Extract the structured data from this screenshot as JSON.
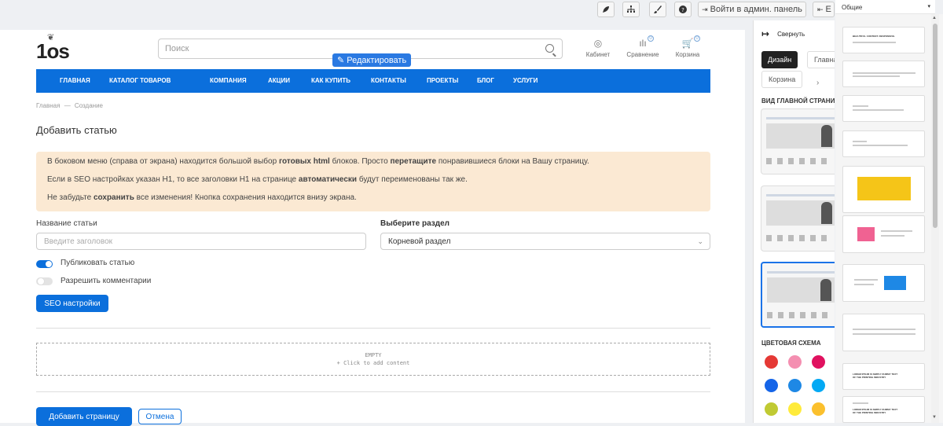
{
  "topbar": {
    "button_admin": "Войти в админ. панель",
    "button_exit": "Е"
  },
  "header": {
    "logo": "1os",
    "search_placeholder": "Поиск",
    "cabinet": "Кабинет",
    "compare": "Сравнение",
    "compare_count": "0",
    "cart": "Корзина",
    "cart_count": "0",
    "edit_button": "Редактировать"
  },
  "nav": {
    "items": [
      "ГЛАВНАЯ",
      "КАТАЛОГ ТОВАРОВ",
      "КОМПАНИЯ",
      "АКЦИИ",
      "КАК КУПИТЬ",
      "КОНТАКТЫ",
      "ПРОЕКТЫ",
      "БЛОГ",
      "УСЛУГИ"
    ]
  },
  "breadcrumb": {
    "home": "Главная",
    "sep": "—",
    "current": "Создание"
  },
  "main": {
    "title": "Добавить статью",
    "notice": {
      "l1_a": "В боковом меню (справа от экрана) находится большой выбор ",
      "l1_b": "готовых html",
      "l1_c": " блоков. Просто ",
      "l1_d": "перетащите",
      "l1_e": " понравившиеся блоки на Вашу страницу.",
      "l2_a": "Если в SEO настройках указан H1, то все заголовки H1 на странице ",
      "l2_b": "автоматически",
      "l2_c": " будут переименованы так же.",
      "l3_a": "Не забудьте ",
      "l3_b": "сохранить",
      "l3_c": " все изменения! Кнопка сохранения находится внизу экрана."
    },
    "article_name_label": "Название статьи",
    "article_name_placeholder": "Введите заголовок",
    "section_label": "Выберите раздел",
    "section_value": "Корневой раздел",
    "publish_label": "Публиковать статью",
    "comments_label": "Разрешить комментарии",
    "seo_button": "SEO настройки",
    "empty_title": "EMPTY",
    "empty_hint": "+ Click to add content",
    "add_button": "Добавить страницу",
    "cancel_button": "Отмена"
  },
  "side_panel": {
    "collapse": "Свернуть",
    "tab_design": "Дизайн",
    "tab_main": "Главна",
    "tab_cart": "Корзина",
    "main_view_heading": "ВИД ГЛАВНОЙ СТРАНИ",
    "color_heading": "ЦВЕТОВАЯ СХЕМА",
    "colors": [
      "#e53935",
      "#f48fb1",
      "#e0115f",
      "#1565e8",
      "#1e88e5",
      "#03a9f4",
      "#c0ca33",
      "#ffeb3b",
      "#fbc02d"
    ]
  },
  "blocks_panel": {
    "category": "Общие",
    "block1_text": "BEAUTIFUL CONTENT. RESPONSIVE.",
    "block9_text": "LOREM IPSUM IS SIMPLY DUMMY TEXT OF THE PRINTING INDUSTRY",
    "block10_text": "LOREM IPSUM IS SIMPLY DUMMY TEXT OF THE PRINTING INDUSTRY",
    "accent_yellow": "#f5c518",
    "accent_pink": "#f06292",
    "accent_blue": "#1e88e5"
  }
}
